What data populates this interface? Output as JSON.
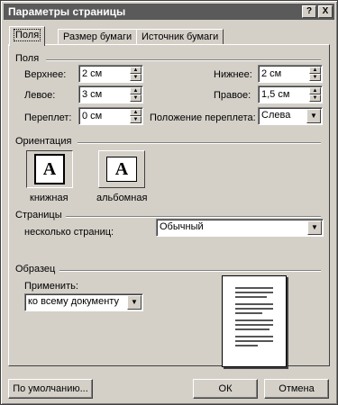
{
  "window": {
    "title": "Параметры страницы",
    "help_btn": "?",
    "close_btn": "X"
  },
  "tabs": [
    {
      "label": "Поля",
      "active": true
    },
    {
      "label": "Размер бумаги",
      "active": false
    },
    {
      "label": "Источник бумаги",
      "active": false
    }
  ],
  "margins": {
    "group_title": "Поля",
    "top": {
      "label": "Верхнее:",
      "value": "2 см"
    },
    "bottom": {
      "label": "Нижнее:",
      "value": "2 см"
    },
    "left": {
      "label": "Левое:",
      "value": "3 см"
    },
    "right": {
      "label": "Правое:",
      "value": "1,5 см"
    },
    "gutter": {
      "label": "Переплет:",
      "value": "0 см"
    },
    "gutter_position": {
      "label": "Положение переплета:",
      "value": "Слева"
    }
  },
  "orientation": {
    "group_title": "Ориентация",
    "portrait": {
      "label": "книжная",
      "glyph": "A",
      "selected": true
    },
    "landscape": {
      "label": "альбомная",
      "glyph": "A",
      "selected": false
    }
  },
  "pages": {
    "group_title": "Страницы",
    "multiple_label": "несколько страниц:",
    "multiple_value": "Обычный"
  },
  "preview": {
    "group_title": "Образец",
    "apply_label": "Применить:",
    "apply_value": "ко всему документу"
  },
  "buttons": {
    "default": "По умолчанию...",
    "ok": "ОК",
    "cancel": "Отмена"
  },
  "icons": {
    "spin_up": "up-arrow-icon",
    "spin_down": "down-arrow-icon",
    "dropdown": "chevron-down-icon"
  }
}
